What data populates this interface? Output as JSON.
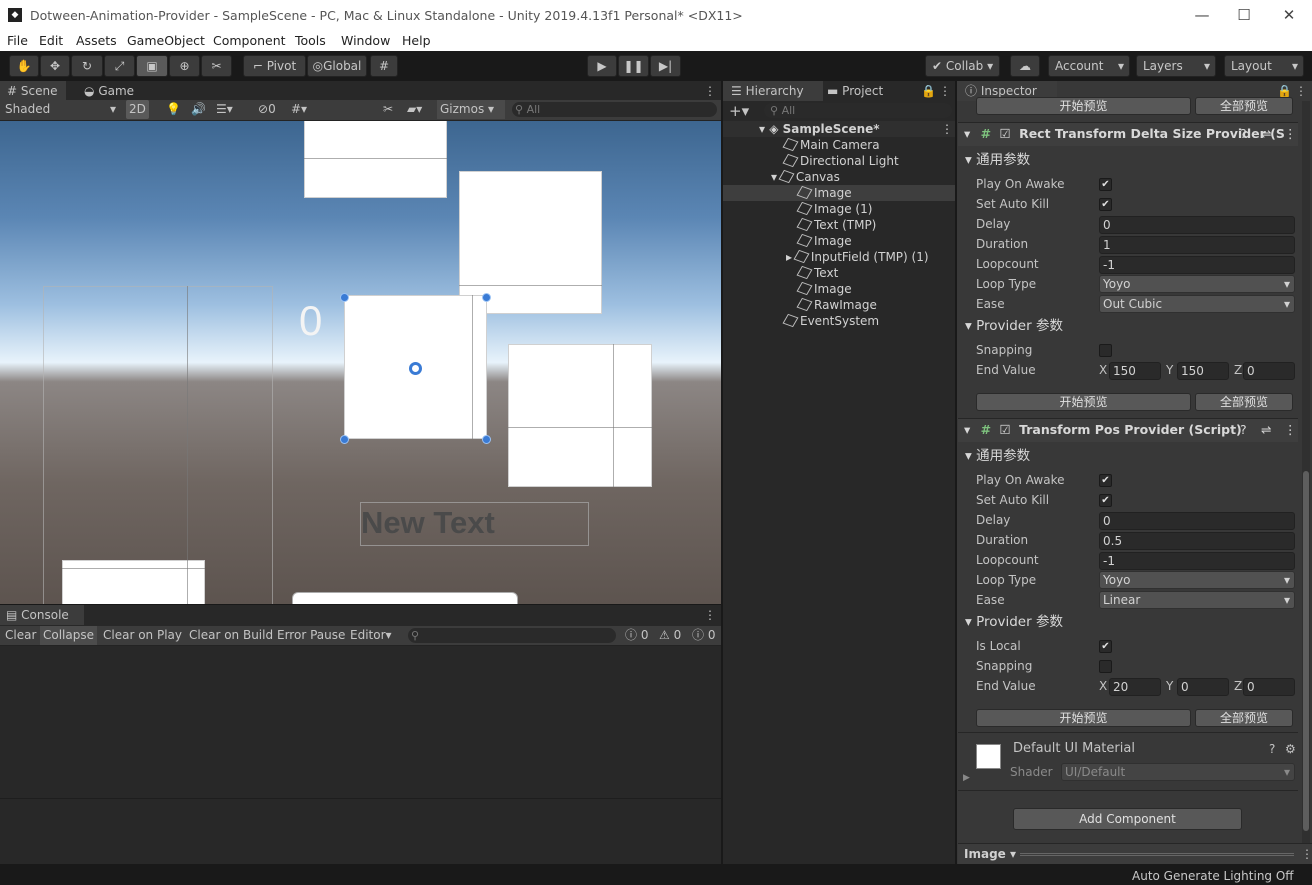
{
  "window": {
    "title": "Dotween-Animation-Provider - SampleScene - PC, Mac & Linux Standalone - Unity 2019.4.13f1 Personal* <DX11>",
    "minimize": "—",
    "maximize": "☐",
    "close": "✕"
  },
  "menu": [
    "File",
    "Edit",
    "Assets",
    "GameObject",
    "Component",
    "Tools",
    "Window",
    "Help"
  ],
  "toolbar": {
    "pivot": "Pivot",
    "global": "Global",
    "collab": "Collab",
    "account": "Account",
    "layers": "Layers",
    "layout": "Layout"
  },
  "scene": {
    "tab_scene": "Scene",
    "tab_game": "Game",
    "shading": "Shaded",
    "mode_2d": "2D",
    "hidden_count": "0",
    "gizmos": "Gizmos",
    "search_placeholder": "All",
    "number_text": "0",
    "new_text": "New Text"
  },
  "console": {
    "tab": "Console",
    "buttons": [
      "Clear",
      "Collapse",
      "Clear on Play",
      "Clear on Build",
      "Error Pause",
      "Editor"
    ],
    "log_count": "0",
    "warn_count": "0",
    "error_count": "0"
  },
  "hierarchy": {
    "tab": "Hierarchy",
    "tab_project": "Project",
    "search_placeholder": "All",
    "scene": "SampleScene*",
    "items": [
      "Main Camera",
      "Directional Light",
      "Canvas",
      "Image",
      "Image (1)",
      "Text (TMP)",
      "Image",
      "InputField (TMP) (1)",
      "Text",
      "Image",
      "RawImage",
      "EventSystem"
    ]
  },
  "inspector": {
    "tab": "Inspector",
    "preview_start": "开始预览",
    "preview_all": "全部预览",
    "comp1": {
      "title": "Rect Transform Delta Size Provider (S",
      "general": "通用参数",
      "play_on_awake": "Play On Awake",
      "set_auto_kill": "Set Auto Kill",
      "delay_label": "Delay",
      "delay": "0",
      "duration_label": "Duration",
      "duration": "1",
      "loopcount_label": "Loopcount",
      "loopcount": "-1",
      "looptype_label": "Loop Type",
      "looptype": "Yoyo",
      "ease_label": "Ease",
      "ease": "Out Cubic",
      "provider": "Provider 参数",
      "snapping": "Snapping",
      "end_value": "End Value",
      "x": "150",
      "y": "150",
      "z": "0"
    },
    "comp2": {
      "title": "Transform Pos Provider (Script)",
      "general": "通用参数",
      "play_on_awake": "Play On Awake",
      "set_auto_kill": "Set Auto Kill",
      "delay_label": "Delay",
      "delay": "0",
      "duration_label": "Duration",
      "duration": "0.5",
      "loopcount_label": "Loopcount",
      "loopcount": "-1",
      "looptype_label": "Loop Type",
      "looptype": "Yoyo",
      "ease_label": "Ease",
      "ease": "Linear",
      "provider": "Provider 参数",
      "is_local": "Is Local",
      "snapping": "Snapping",
      "end_value": "End Value",
      "x": "20",
      "y": "0",
      "z": "0"
    },
    "material": {
      "name": "Default UI Material",
      "shader_label": "Shader",
      "shader": "UI/Default"
    },
    "add_component": "Add Component",
    "preview_label": "Image"
  },
  "status": {
    "lighting": "Auto Generate Lighting Off"
  },
  "axes": {
    "x": "X",
    "y": "Y",
    "z": "Z"
  }
}
